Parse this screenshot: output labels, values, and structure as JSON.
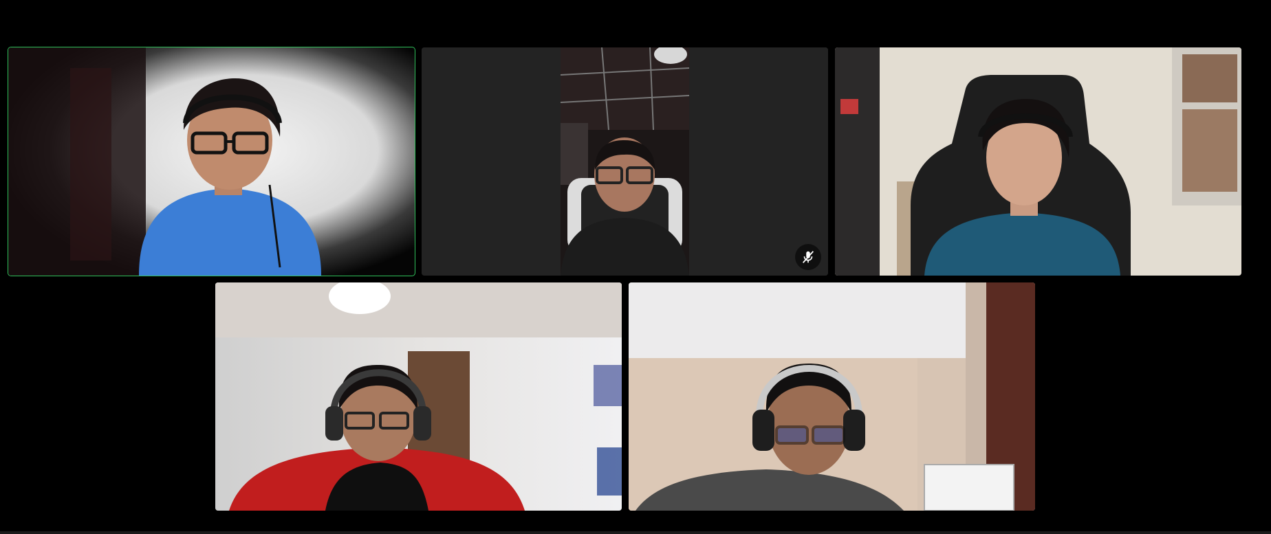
{
  "app": {
    "view": "gallery-view"
  },
  "colors": {
    "active_speaker_border": "#2fc25b",
    "tile_background": "#232323",
    "page_background": "#000000"
  },
  "participants": [
    {
      "name": "",
      "muted": false,
      "active_speaker": true,
      "camera": "on"
    },
    {
      "name": "",
      "muted": true,
      "active_speaker": false,
      "camera": "on",
      "icon": "microphone-muted-icon"
    },
    {
      "name": "",
      "muted": false,
      "active_speaker": false,
      "camera": "on"
    },
    {
      "name": "",
      "muted": false,
      "active_speaker": false,
      "camera": "on"
    },
    {
      "name": "",
      "muted": false,
      "active_speaker": false,
      "camera": "on"
    }
  ]
}
